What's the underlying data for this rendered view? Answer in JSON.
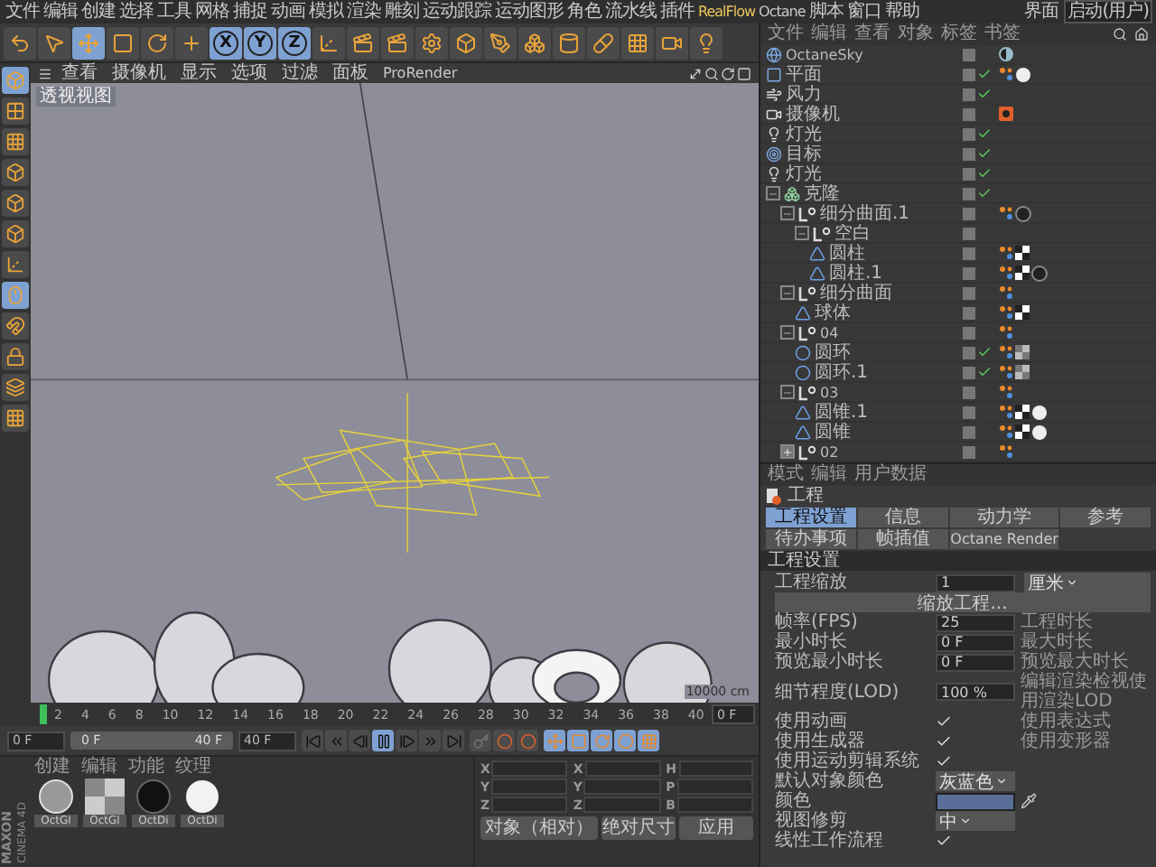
{
  "menubar": {
    "items": [
      "文件",
      "编辑",
      "创建",
      "选择",
      "工具",
      "网格",
      "捕捉",
      "动画",
      "模拟",
      "渲染",
      "雕刻",
      "运动跟踪",
      "运动图形",
      "角色",
      "流水线",
      "插件",
      "RealFlow",
      "Octane",
      "脚本",
      "窗口",
      "帮助"
    ],
    "layout_label": "界面",
    "layout_value": "启动(用户)"
  },
  "toolbar": [
    {
      "kind": "undo",
      "selected": false
    },
    {
      "kind": "cursor",
      "selected": false
    },
    {
      "kind": "move",
      "selected": true
    },
    {
      "kind": "scale",
      "selected": false
    },
    {
      "kind": "rotate",
      "selected": false
    },
    {
      "kind": "add",
      "selected": false
    },
    {
      "kind": "axis",
      "label": "X",
      "selected": true
    },
    {
      "kind": "axis",
      "label": "Y",
      "selected": true
    },
    {
      "kind": "axis",
      "label": "Z",
      "selected": true
    },
    {
      "kind": "coords",
      "selected": false
    },
    {
      "kind": "render-view",
      "selected": false
    },
    {
      "kind": "render",
      "selected": false
    },
    {
      "kind": "render-settings",
      "selected": false
    },
    {
      "kind": "cube",
      "selected": false
    },
    {
      "kind": "pen",
      "selected": false
    },
    {
      "kind": "cloner",
      "selected": false
    },
    {
      "kind": "deformer",
      "selected": false
    },
    {
      "kind": "capsule",
      "selected": false
    },
    {
      "kind": "floor",
      "selected": false
    },
    {
      "kind": "camera",
      "selected": false
    },
    {
      "kind": "light",
      "selected": false
    }
  ],
  "tool_strip": [
    {
      "kind": "model",
      "selected": true
    },
    {
      "kind": "texture",
      "selected": false
    },
    {
      "kind": "texture-axis",
      "selected": false
    },
    {
      "kind": "points",
      "selected": false
    },
    {
      "kind": "edges",
      "selected": false
    },
    {
      "kind": "polygons",
      "selected": false
    },
    {
      "kind": "axis",
      "selected": false
    },
    {
      "kind": "tweak",
      "selected": true
    },
    {
      "kind": "snap",
      "selected": false
    },
    {
      "kind": "lock",
      "selected": false
    },
    {
      "kind": "workplane",
      "selected": false
    },
    {
      "kind": "grid",
      "selected": false
    }
  ],
  "viewport": {
    "menu": [
      "查看",
      "摄像机",
      "显示",
      "选项",
      "过滤",
      "面板",
      "ProRender"
    ],
    "label": "透视视图",
    "grid_spacing": "10000 cm"
  },
  "timeline": {
    "ticks": [
      "2",
      "4",
      "6",
      "8",
      "10",
      "12",
      "14",
      "16",
      "18",
      "20",
      "22",
      "24",
      "26",
      "28",
      "30",
      "32",
      "34",
      "36",
      "38",
      "40"
    ],
    "current": "0 F"
  },
  "controls": {
    "start": "0 F",
    "range_start": "0 F",
    "range_end": "40 F",
    "end": "40 F",
    "transport": [
      {
        "kind": "first",
        "selected": false
      },
      {
        "kind": "prev-key",
        "selected": false
      },
      {
        "kind": "prev-frame",
        "selected": false
      },
      {
        "kind": "pause",
        "selected": true
      },
      {
        "kind": "next-frame",
        "selected": false
      },
      {
        "kind": "next-key",
        "selected": false
      },
      {
        "kind": "last",
        "selected": false
      }
    ],
    "keys": [
      {
        "kind": "key"
      },
      {
        "kind": "record"
      },
      {
        "kind": "auto"
      }
    ],
    "key_modes": [
      {
        "kind": "move",
        "selected": true
      },
      {
        "kind": "scale",
        "selected": true
      },
      {
        "kind": "rotate",
        "selected": true
      },
      {
        "kind": "param",
        "selected": true
      },
      {
        "kind": "points",
        "selected": true
      }
    ]
  },
  "materials": {
    "menu": [
      "创建",
      "编辑",
      "功能",
      "纹理"
    ],
    "items": [
      {
        "name": "OctGl",
        "kind": "chrome"
      },
      {
        "name": "OctGl",
        "kind": "checker"
      },
      {
        "name": "OctDi",
        "kind": "black"
      },
      {
        "name": "OctDi",
        "kind": "white"
      }
    ]
  },
  "coordinates": {
    "rows": [
      [
        "X",
        "X",
        "H"
      ],
      [
        "Y",
        "Y",
        "P"
      ],
      [
        "Z",
        "Z",
        "B"
      ]
    ],
    "buttons": [
      "对象（相对）",
      "绝对尺寸",
      "应用"
    ]
  },
  "logo": {
    "brand": "MAXON",
    "product": "CINEMA 4D"
  },
  "object_manager": {
    "menu": [
      "文件",
      "编辑",
      "查看",
      "对象",
      "标签",
      "书签"
    ],
    "objects": [
      {
        "name": "OctaneSky",
        "kind": "sky",
        "enabled": false,
        "tags": [
          {
            "kind": "half-circle"
          }
        ]
      },
      {
        "name": "平面",
        "kind": "plane",
        "enabled": true,
        "tags": [
          {
            "kind": "dots"
          },
          {
            "kind": "white-sphere"
          }
        ]
      },
      {
        "name": "风力",
        "kind": "wind",
        "enabled": true
      },
      {
        "name": "摄像机",
        "kind": "camera",
        "enabled": false,
        "tags": [
          {
            "kind": "camera-tag"
          }
        ]
      },
      {
        "name": "灯光",
        "kind": "light",
        "enabled": true
      },
      {
        "name": "目标",
        "kind": "target",
        "enabled": true
      },
      {
        "name": "灯光",
        "kind": "light",
        "enabled": true
      },
      {
        "name": "克隆",
        "kind": "cloner",
        "enabled": true,
        "expanded": true,
        "children": [
          {
            "name": "细分曲面.1",
            "kind": "null",
            "enabled": false,
            "expanded": true,
            "tags": [
              {
                "kind": "dots"
              },
              {
                "kind": "dark-sphere"
              }
            ],
            "children": [
              {
                "name": "空白",
                "kind": "null",
                "enabled": false,
                "expanded": true,
                "children": [
                  {
                    "name": "圆柱",
                    "kind": "primitive",
                    "enabled": false,
                    "tags": [
                      {
                        "kind": "dots"
                      },
                      {
                        "kind": "checker"
                      }
                    ]
                  },
                  {
                    "name": "圆柱.1",
                    "kind": "primitive",
                    "enabled": false,
                    "tags": [
                      {
                        "kind": "dots"
                      },
                      {
                        "kind": "checker"
                      },
                      {
                        "kind": "dark-sphere"
                      }
                    ]
                  }
                ]
              }
            ]
          },
          {
            "name": "细分曲面",
            "kind": "null",
            "enabled": false,
            "expanded": true,
            "tags": [
              {
                "kind": "dots"
              }
            ],
            "children": [
              {
                "name": "球体",
                "kind": "primitive",
                "enabled": false,
                "tags": [
                  {
                    "kind": "dots"
                  },
                  {
                    "kind": "checker"
                  }
                ]
              }
            ]
          },
          {
            "name": "04",
            "kind": "null",
            "enabled": false,
            "expanded": true,
            "tags": [
              {
                "kind": "dots"
              }
            ],
            "children": [
              {
                "name": "圆环",
                "kind": "torus",
                "enabled": true,
                "tags": [
                  {
                    "kind": "dots"
                  },
                  {
                    "kind": "grey-checker"
                  }
                ]
              },
              {
                "name": "圆环.1",
                "kind": "torus",
                "enabled": true,
                "tags": [
                  {
                    "kind": "dots"
                  },
                  {
                    "kind": "grey-checker"
                  }
                ]
              }
            ]
          },
          {
            "name": "03",
            "kind": "null",
            "enabled": false,
            "expanded": true,
            "tags": [
              {
                "kind": "dots"
              }
            ],
            "children": [
              {
                "name": "圆锥.1",
                "kind": "primitive",
                "enabled": false,
                "tags": [
                  {
                    "kind": "dots"
                  },
                  {
                    "kind": "checker"
                  },
                  {
                    "kind": "white-sphere"
                  }
                ]
              },
              {
                "name": "圆锥",
                "kind": "primitive",
                "enabled": false,
                "tags": [
                  {
                    "kind": "dots"
                  },
                  {
                    "kind": "checker"
                  },
                  {
                    "kind": "white-sphere"
                  }
                ]
              }
            ]
          },
          {
            "name": "02",
            "kind": "null",
            "enabled": false,
            "expanded": false,
            "tags": [
              {
                "kind": "dots"
              }
            ]
          }
        ]
      }
    ]
  },
  "attributes": {
    "menu": [
      "模式",
      "编辑",
      "用户数据"
    ],
    "title": "工程",
    "tabs": [
      {
        "label": "工程设置",
        "selected": true
      },
      {
        "label": "信息",
        "selected": false
      },
      {
        "label": "动力学",
        "selected": false
      },
      {
        "label": "参考",
        "selected": false
      },
      {
        "label": "待办事项",
        "selected": false
      },
      {
        "label": "帧插值",
        "selected": false
      },
      {
        "label": "Octane Render",
        "selected": false
      }
    ],
    "section": "工程设置",
    "rows": [
      {
        "kind": "number",
        "label": "工程缩放",
        "value": "1",
        "unit": "厘米"
      },
      {
        "kind": "button",
        "label": "缩放工程..."
      },
      {
        "kind": "number",
        "label": "帧率(FPS)",
        "value": "25",
        "side": "工程时长"
      },
      {
        "kind": "number",
        "label": "最小时长",
        "value": "0 F",
        "side": "最大时长"
      },
      {
        "kind": "number",
        "label": "预览最小时长",
        "value": "0 F",
        "side": "预览最大时长"
      },
      {
        "kind": "number",
        "label": "细节程度(LOD)",
        "value": "100 %",
        "side": "编辑渲染检视使用渲染LOD"
      },
      {
        "kind": "check",
        "label": "使用动画",
        "checked": true,
        "side": "使用表达式"
      },
      {
        "kind": "check",
        "label": "使用生成器",
        "checked": true,
        "side": "使用变形器"
      },
      {
        "kind": "check",
        "label": "使用运动剪辑系统",
        "checked": true
      },
      {
        "kind": "select",
        "label": "默认对象颜色",
        "value": "灰蓝色"
      },
      {
        "kind": "color",
        "label": "颜色",
        "color": "#5a6e9a"
      },
      {
        "kind": "select",
        "label": "视图修剪",
        "value": "中"
      },
      {
        "kind": "check",
        "label": "线性工作流程",
        "checked": true
      }
    ]
  }
}
